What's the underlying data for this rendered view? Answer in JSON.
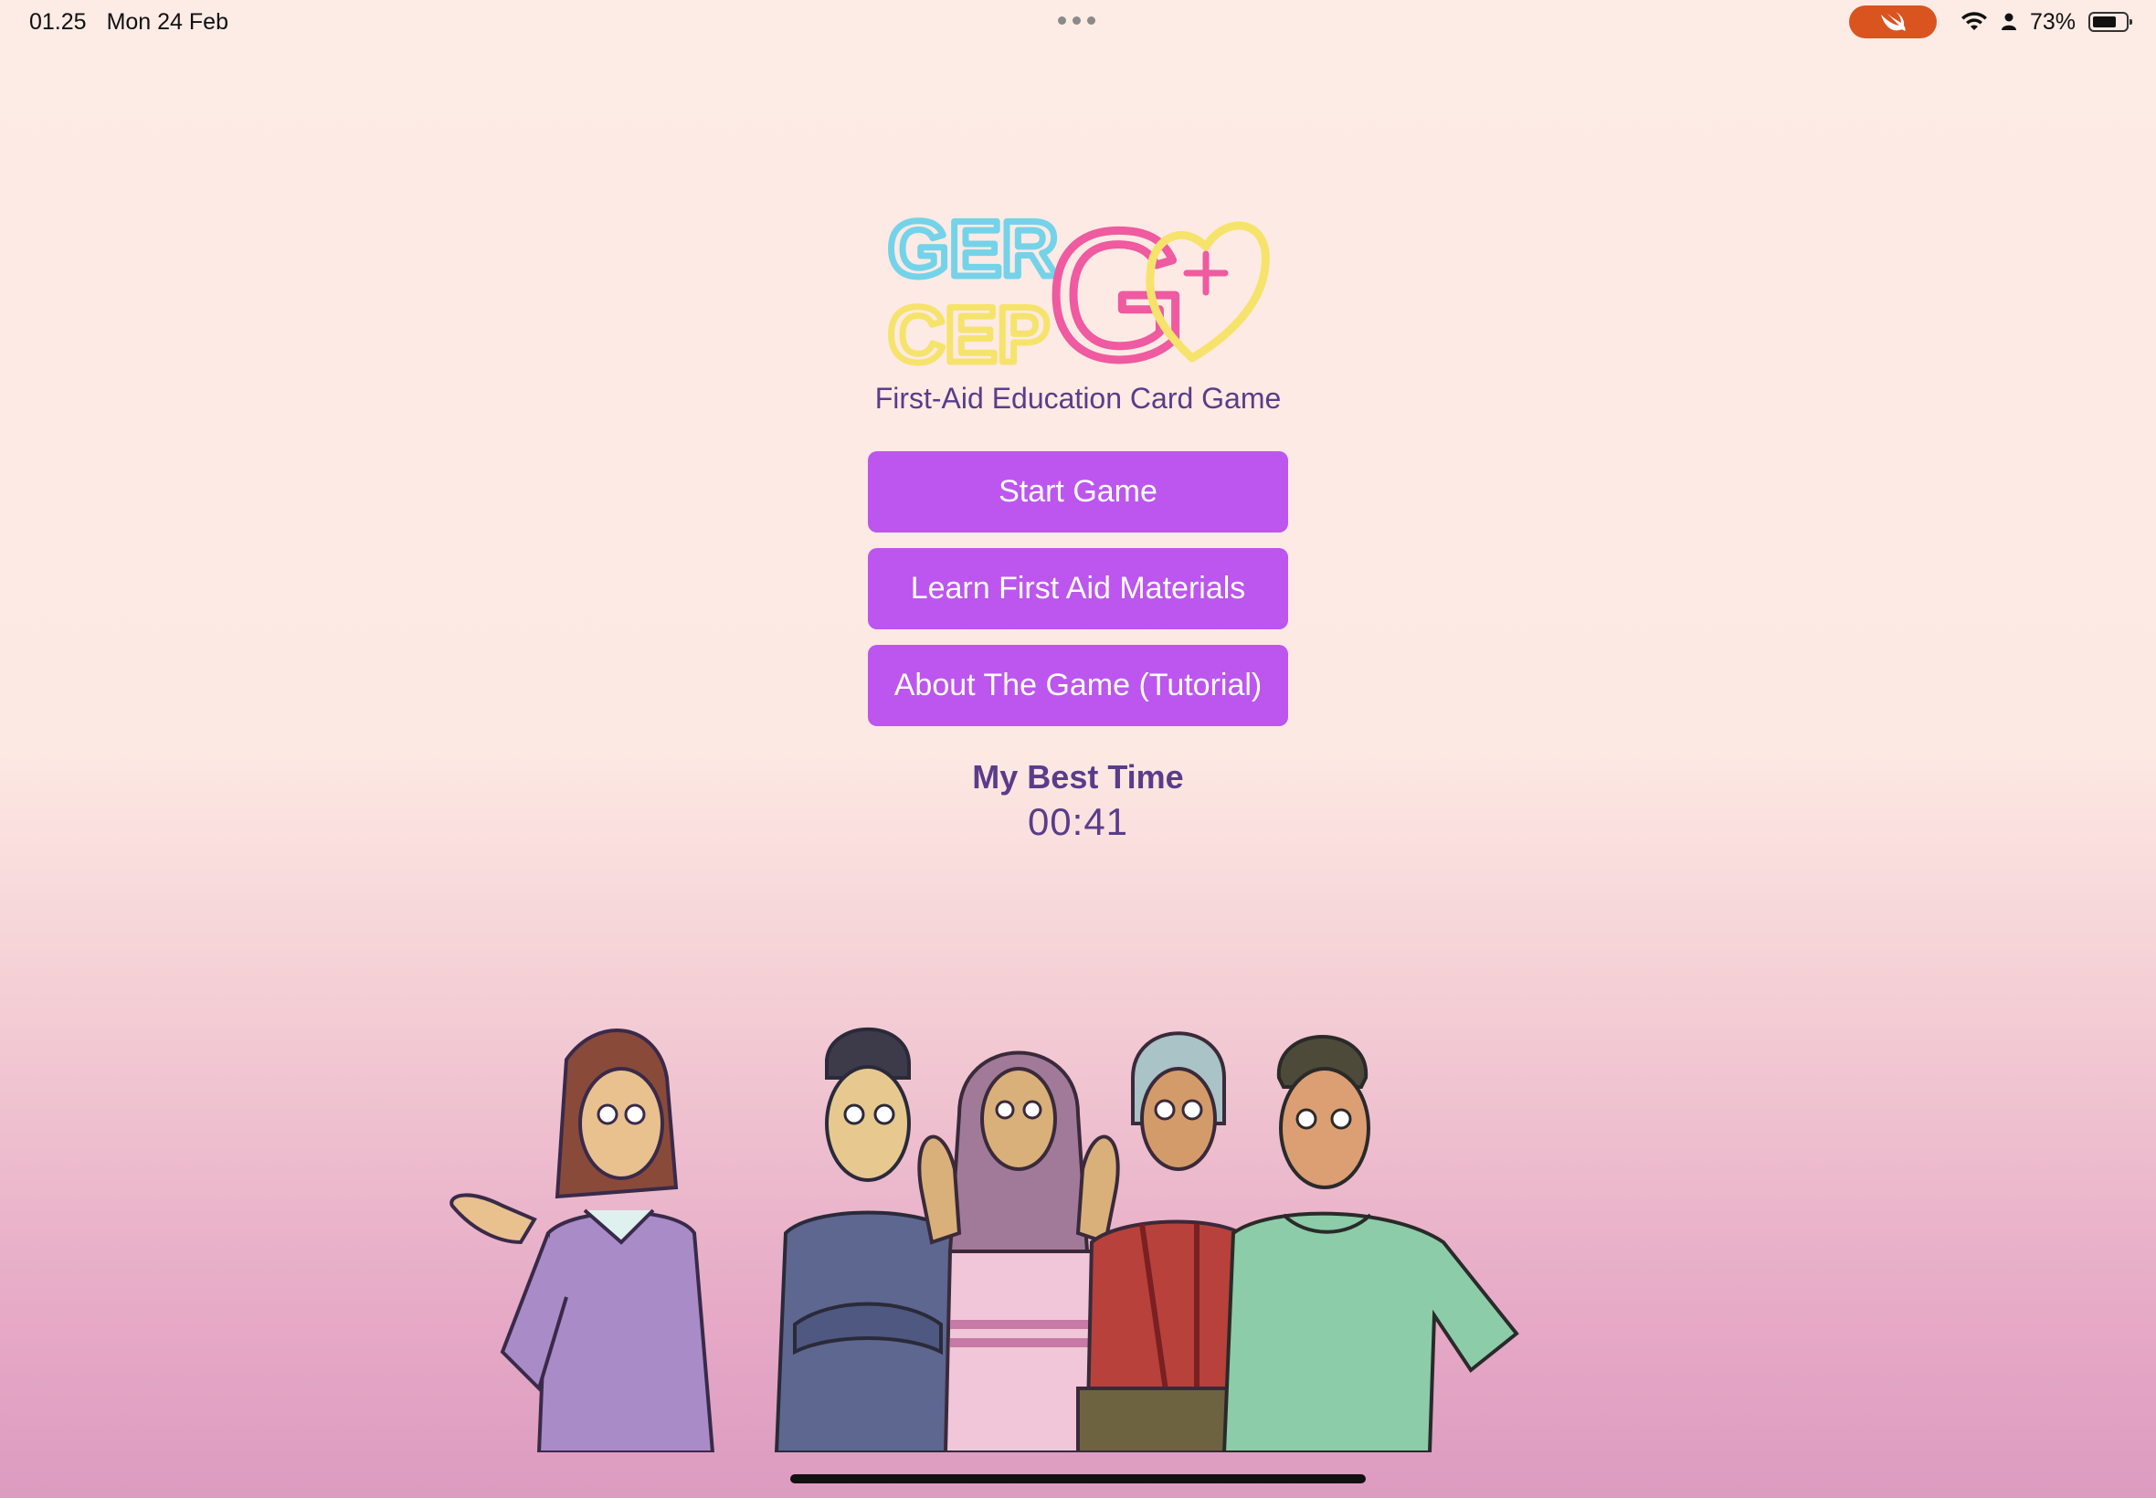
{
  "status_bar": {
    "time": "01.25",
    "date": "Mon 24 Feb",
    "battery_percent_label": "73%",
    "battery_level": 0.73,
    "recording_pill_color": "#d9541f"
  },
  "logo": {
    "line1": "GER",
    "line2": "CEP",
    "big_letter": "G",
    "accent_colors": [
      "#74d3e8",
      "#ef5aa0",
      "#f6e36c",
      "#a968e0"
    ]
  },
  "subtitle": "First-Aid Education Card Game",
  "menu": {
    "start_label": "Start Game",
    "learn_label": "Learn First Aid Materials",
    "about_label": "About The Game (Tutorial)",
    "button_color": "#bc56ee"
  },
  "best_time": {
    "label": "My Best Time",
    "value": "00:41"
  },
  "icons": [
    "swift-icon",
    "wifi-icon",
    "person-icon",
    "battery-icon",
    "heart-plus-icon"
  ]
}
